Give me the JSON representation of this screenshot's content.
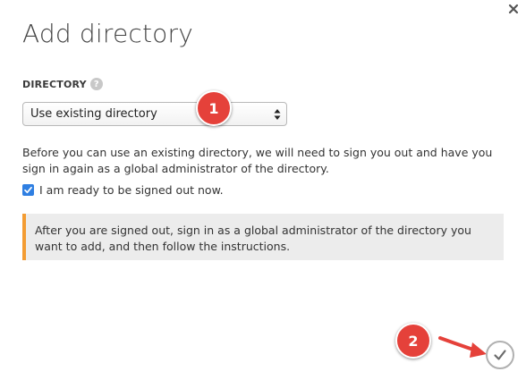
{
  "dialog": {
    "title": "Add directory",
    "close_icon": "close-icon"
  },
  "directory_field": {
    "label": "DIRECTORY",
    "help_icon": "help-icon",
    "help_glyph": "?",
    "selected_value": "Use existing directory"
  },
  "description": "Before you can use an existing directory, we will need to sign you out and have you sign in again as a global administrator of the directory.",
  "ready_checkbox": {
    "checked": true,
    "label": "I am ready to be signed out now."
  },
  "notice": {
    "text": "After you are signed out, sign in as a global administrator of the directory you want to add, and then follow the instructions.",
    "accent_color": "#f39c33"
  },
  "annotations": {
    "step_1": "1",
    "step_2": "2",
    "badge_color": "#e5413a"
  },
  "confirm": {
    "icon": "checkmark-icon"
  }
}
